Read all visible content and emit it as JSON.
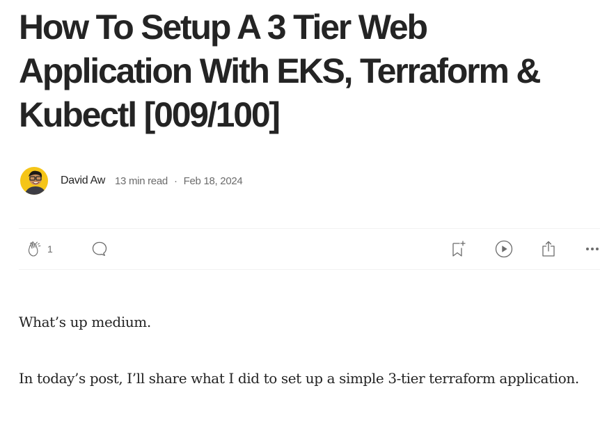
{
  "article": {
    "title": "How To Setup A 3 Tier Web Application With EKS, Terraform & Kubectl [009/100]",
    "author": "David Aw",
    "read_time": "13 min read",
    "separator": "·",
    "date": "Feb 18, 2024",
    "avatar_icon": "author-avatar",
    "paragraphs": [
      "What’s up medium.",
      "In today’s post, I’ll share what I did to set up a simple 3-tier terraform application."
    ]
  },
  "actions": {
    "clap_count": "1",
    "icons": {
      "clap": "clap-icon",
      "comment": "comment-icon",
      "save": "bookmark-add-icon",
      "listen": "play-circle-icon",
      "share": "share-icon",
      "more": "more-horizontal-icon"
    }
  },
  "colors": {
    "text": "#242424",
    "muted": "#6b6b6b",
    "divider": "#f2f2f2",
    "avatar_bg": "#f5c518"
  }
}
